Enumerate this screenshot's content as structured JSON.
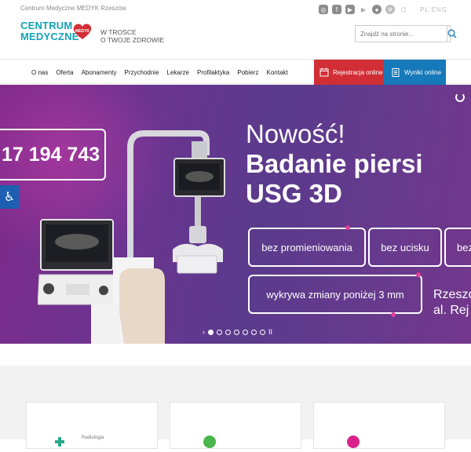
{
  "header": {
    "site_name": "Centrum Medyczne MEDYK Rzeszów",
    "logo_line1": "CENTRUM",
    "logo_line2": "MEDYCZNE",
    "logo_badge": "MEDYK",
    "slogan_line1": "W TROSCE",
    "slogan_line2": "O TWOJE ZDROWIE",
    "social_icons": [
      "instagram-icon",
      "facebook-icon",
      "youtube-icon",
      "google-play-icon",
      "podcast-icon",
      "settings-icon",
      "badge-icon"
    ],
    "lang": "PL  ENG",
    "search_placeholder": "Znajdź na stronie..."
  },
  "nav": {
    "items": [
      "O nas",
      "Oferta",
      "Abonamenty",
      "Przychodnie",
      "Lekarze",
      "Profilaktyka",
      "Pobierz",
      "Kontakt"
    ],
    "registration_label": "Rejestracja online",
    "results_label": "Wyniki online",
    "colors": {
      "registration": "#d12e35",
      "results": "#1679b9"
    }
  },
  "hero": {
    "phone": "17 194 743",
    "headline_line1": "Nowość!",
    "headline_line2": "Badanie piersi",
    "headline_line3": "USG 3D",
    "pills": [
      "bez promieniowania",
      "bez ucisku",
      "bez",
      "wykrywa zmiany poniżej 3 mm"
    ],
    "location_line1": "Rzeszó",
    "location_line2": "al. Rej",
    "slide_count": 7,
    "active_slide": 1,
    "colors": {
      "gradient_start": "#7e2a8a",
      "gradient_end": "#5b3a8c",
      "accent": "#e23d9a"
    }
  },
  "cards": {
    "labels": [
      "Radiologia",
      "",
      ""
    ]
  }
}
